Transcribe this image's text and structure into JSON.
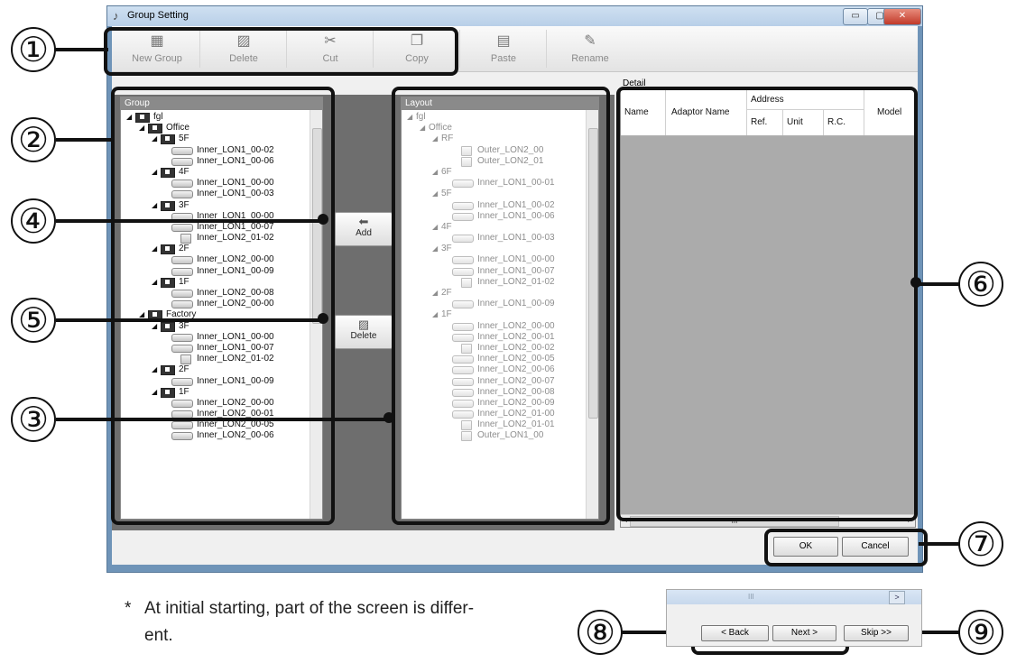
{
  "window": {
    "title": "Group Setting",
    "min": "▭",
    "max": "▢",
    "close": "✕"
  },
  "toolbar": [
    {
      "label": "New Group",
      "icon": "new-group-icon",
      "glyph": "▦"
    },
    {
      "label": "Delete",
      "icon": "delete-icon",
      "glyph": "▨"
    },
    {
      "label": "Cut",
      "icon": "cut-icon",
      "glyph": "✂"
    },
    {
      "label": "Copy",
      "icon": "copy-icon",
      "glyph": "❐"
    },
    {
      "label": "Paste",
      "icon": "paste-icon",
      "glyph": "▤"
    },
    {
      "label": "Rename",
      "icon": "rename-icon",
      "glyph": "✎"
    }
  ],
  "group_panel": {
    "title": "Group",
    "items": [
      {
        "label": "fgl",
        "level": 0,
        "kind": "group"
      },
      {
        "label": "Office",
        "level": 1,
        "kind": "group"
      },
      {
        "label": "5F",
        "level": 2,
        "kind": "group"
      },
      {
        "label": "Inner_LON1_00-02",
        "level": 3,
        "kind": "unit"
      },
      {
        "label": "Inner_LON1_00-06",
        "level": 3,
        "kind": "unit"
      },
      {
        "label": "4F",
        "level": 2,
        "kind": "group"
      },
      {
        "label": "Inner_LON1_00-00",
        "level": 3,
        "kind": "unit"
      },
      {
        "label": "Inner_LON1_00-03",
        "level": 3,
        "kind": "unit"
      },
      {
        "label": "3F",
        "level": 2,
        "kind": "group"
      },
      {
        "label": "Inner_LON1_00-00",
        "level": 3,
        "kind": "unit"
      },
      {
        "label": "Inner_LON1_00-07",
        "level": 3,
        "kind": "unit"
      },
      {
        "label": "Inner_LON2_01-02",
        "level": 3,
        "kind": "box"
      },
      {
        "label": "2F",
        "level": 2,
        "kind": "group"
      },
      {
        "label": "Inner_LON2_00-00",
        "level": 3,
        "kind": "unit"
      },
      {
        "label": "Inner_LON1_00-09",
        "level": 3,
        "kind": "unit"
      },
      {
        "label": "1F",
        "level": 2,
        "kind": "group"
      },
      {
        "label": "Inner_LON2_00-08",
        "level": 3,
        "kind": "unit"
      },
      {
        "label": "Inner_LON2_00-00",
        "level": 3,
        "kind": "unit"
      },
      {
        "label": "Factory",
        "level": 1,
        "kind": "group"
      },
      {
        "label": "3F",
        "level": 2,
        "kind": "group"
      },
      {
        "label": "Inner_LON1_00-00",
        "level": 3,
        "kind": "unit"
      },
      {
        "label": "Inner_LON1_00-07",
        "level": 3,
        "kind": "unit"
      },
      {
        "label": "Inner_LON2_01-02",
        "level": 3,
        "kind": "box"
      },
      {
        "label": "2F",
        "level": 2,
        "kind": "group"
      },
      {
        "label": "Inner_LON1_00-09",
        "level": 3,
        "kind": "unit"
      },
      {
        "label": "1F",
        "level": 2,
        "kind": "group"
      },
      {
        "label": "Inner_LON2_00-00",
        "level": 3,
        "kind": "unit"
      },
      {
        "label": "Inner_LON2_00-01",
        "level": 3,
        "kind": "unit"
      },
      {
        "label": "Inner_LON2_00-05",
        "level": 3,
        "kind": "unit"
      },
      {
        "label": "Inner_LON2_00-06",
        "level": 3,
        "kind": "unit"
      }
    ]
  },
  "layout_panel": {
    "title": "Layout",
    "items": [
      {
        "label": "fgl",
        "level": 0,
        "kind": "text"
      },
      {
        "label": "Office",
        "level": 1,
        "kind": "text"
      },
      {
        "label": "RF",
        "level": 2,
        "kind": "text"
      },
      {
        "label": "Outer_LON2_00",
        "level": 3,
        "kind": "box"
      },
      {
        "label": "Outer_LON2_01",
        "level": 3,
        "kind": "box"
      },
      {
        "label": "6F",
        "level": 2,
        "kind": "text"
      },
      {
        "label": "Inner_LON1_00-01",
        "level": 3,
        "kind": "unit"
      },
      {
        "label": "5F",
        "level": 2,
        "kind": "text"
      },
      {
        "label": "Inner_LON1_00-02",
        "level": 3,
        "kind": "unit"
      },
      {
        "label": "Inner_LON1_00-06",
        "level": 3,
        "kind": "unit"
      },
      {
        "label": "4F",
        "level": 2,
        "kind": "text"
      },
      {
        "label": "Inner_LON1_00-03",
        "level": 3,
        "kind": "unit"
      },
      {
        "label": "3F",
        "level": 2,
        "kind": "text"
      },
      {
        "label": "Inner_LON1_00-00",
        "level": 3,
        "kind": "unit"
      },
      {
        "label": "Inner_LON1_00-07",
        "level": 3,
        "kind": "unit"
      },
      {
        "label": "Inner_LON2_01-02",
        "level": 3,
        "kind": "box"
      },
      {
        "label": "2F",
        "level": 2,
        "kind": "text"
      },
      {
        "label": "Inner_LON1_00-09",
        "level": 3,
        "kind": "unit"
      },
      {
        "label": "1F",
        "level": 2,
        "kind": "text"
      },
      {
        "label": "Inner_LON2_00-00",
        "level": 3,
        "kind": "unit"
      },
      {
        "label": "Inner_LON2_00-01",
        "level": 3,
        "kind": "unit"
      },
      {
        "label": "Inner_LON2_00-02",
        "level": 3,
        "kind": "box"
      },
      {
        "label": "Inner_LON2_00-05",
        "level": 3,
        "kind": "unit"
      },
      {
        "label": "Inner_LON2_00-06",
        "level": 3,
        "kind": "unit"
      },
      {
        "label": "Inner_LON2_00-07",
        "level": 3,
        "kind": "unit"
      },
      {
        "label": "Inner_LON2_00-08",
        "level": 3,
        "kind": "unit"
      },
      {
        "label": "Inner_LON2_00-09",
        "level": 3,
        "kind": "unit"
      },
      {
        "label": "Inner_LON2_01-00",
        "level": 3,
        "kind": "unit"
      },
      {
        "label": "Inner_LON2_01-01",
        "level": 3,
        "kind": "box"
      },
      {
        "label": "Outer_LON1_00",
        "level": 3,
        "kind": "box"
      }
    ]
  },
  "buttons": {
    "add": "Add",
    "delete": "Delete",
    "ok": "OK",
    "cancel": "Cancel"
  },
  "detail": {
    "label": "Detail",
    "col_name": "Name",
    "col_adaptor": "Adaptor Name",
    "col_address": "Address",
    "col_ref": "Ref.",
    "col_unit": "Unit",
    "col_rc": "R.C.",
    "col_model": "Model",
    "scroll_left": "◂",
    "scroll_grip": "III",
    "scroll_right": "▸"
  },
  "callouts": [
    "①",
    "②",
    "③",
    "④",
    "⑤",
    "⑥",
    "⑦",
    "⑧",
    "⑨"
  ],
  "note": {
    "star": "*",
    "line1": "At initial starting, part of the screen is differ-",
    "line2": "ent."
  },
  "wizard": {
    "back": "< Back",
    "next": "Next >",
    "skip": "Skip >>",
    "scroll_grip": "III",
    "scroll_arrow": ">"
  }
}
